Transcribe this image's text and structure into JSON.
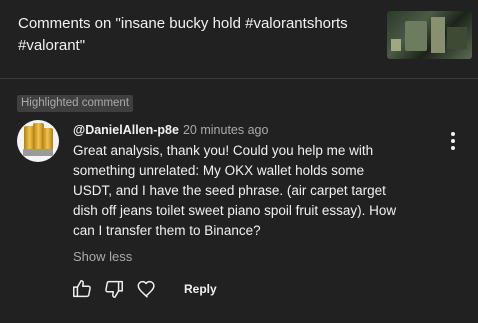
{
  "header": {
    "title": "Comments on \"insane bucky hold #valorantshorts #valorant\""
  },
  "badge": {
    "label": "Highlighted comment"
  },
  "comment": {
    "author": "@DanielAllen-p8e",
    "timestamp": "20 minutes ago",
    "body": "Great analysis, thank you! Could you help me with something unrelated: My OKX wallet holds some USDT, and I have the seed phrase. (air carpet target dish off jeans toilet sweet piano spoil fruit essay). How can I transfer them to Binance?",
    "show_less_label": "Show less"
  },
  "actions": {
    "reply_label": "Reply",
    "like_icon": "thumbs-up-icon",
    "dislike_icon": "thumbs-down-icon",
    "heart_icon": "heart-icon",
    "more_icon": "more-vertical-icon"
  },
  "colors": {
    "background": "#212121",
    "text_primary": "#f1f1f1",
    "text_secondary": "#aaaaaa",
    "badge_bg": "#3f3f3f",
    "divider": "#3d3d3d"
  }
}
